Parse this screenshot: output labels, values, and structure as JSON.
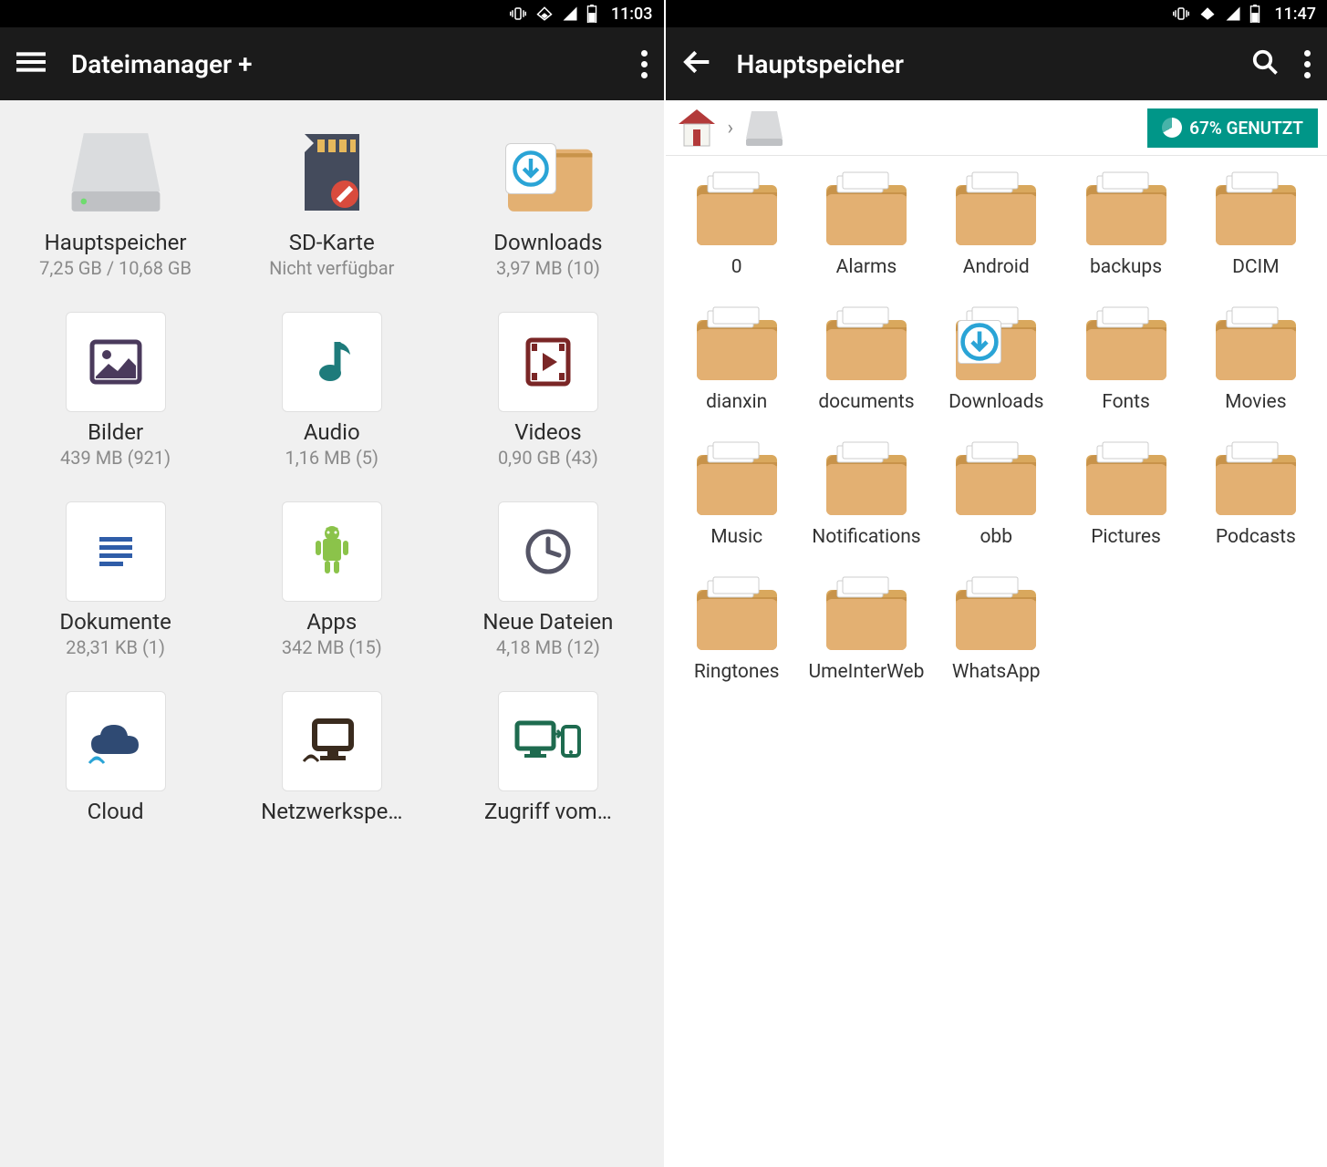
{
  "left": {
    "status": {
      "time": "11:03"
    },
    "appbar": {
      "title": "Dateimanager +"
    },
    "items": [
      {
        "kind": "drive",
        "label": "Hauptspeicher",
        "sub": "7,25 GB / 10,68 GB"
      },
      {
        "kind": "sd",
        "label": "SD-Karte",
        "sub": "Nicht verfügbar"
      },
      {
        "kind": "dl",
        "label": "Downloads",
        "sub": "3,97 MB (10)"
      },
      {
        "kind": "img",
        "label": "Bilder",
        "sub": "439 MB (921)"
      },
      {
        "kind": "audio",
        "label": "Audio",
        "sub": "1,16 MB (5)"
      },
      {
        "kind": "video",
        "label": "Videos",
        "sub": "0,90 GB (43)"
      },
      {
        "kind": "doc",
        "label": "Dokumente",
        "sub": "28,31 KB (1)"
      },
      {
        "kind": "apps",
        "label": "Apps",
        "sub": "342 MB (15)"
      },
      {
        "kind": "recent",
        "label": "Neue Dateien",
        "sub": "4,18 MB (12)"
      },
      {
        "kind": "cloud",
        "label": "Cloud",
        "sub": ""
      },
      {
        "kind": "net",
        "label": "Netzwerkspe…",
        "sub": ""
      },
      {
        "kind": "remote",
        "label": "Zugriff vom…",
        "sub": ""
      }
    ]
  },
  "right": {
    "status": {
      "time": "11:47"
    },
    "appbar": {
      "title": "Hauptspeicher"
    },
    "usage": {
      "text": "67% GENUTZT"
    },
    "folders": [
      {
        "name": "0"
      },
      {
        "name": "Alarms"
      },
      {
        "name": "Android"
      },
      {
        "name": "backups"
      },
      {
        "name": "DCIM"
      },
      {
        "name": "dianxin"
      },
      {
        "name": "documents"
      },
      {
        "name": "Downloads",
        "overlay": "dl"
      },
      {
        "name": "Fonts"
      },
      {
        "name": "Movies"
      },
      {
        "name": "Music"
      },
      {
        "name": "Notifications"
      },
      {
        "name": "obb"
      },
      {
        "name": "Pictures"
      },
      {
        "name": "Podcasts"
      },
      {
        "name": "Ringtones"
      },
      {
        "name": "UmeInterWeb"
      },
      {
        "name": "WhatsApp"
      }
    ]
  }
}
